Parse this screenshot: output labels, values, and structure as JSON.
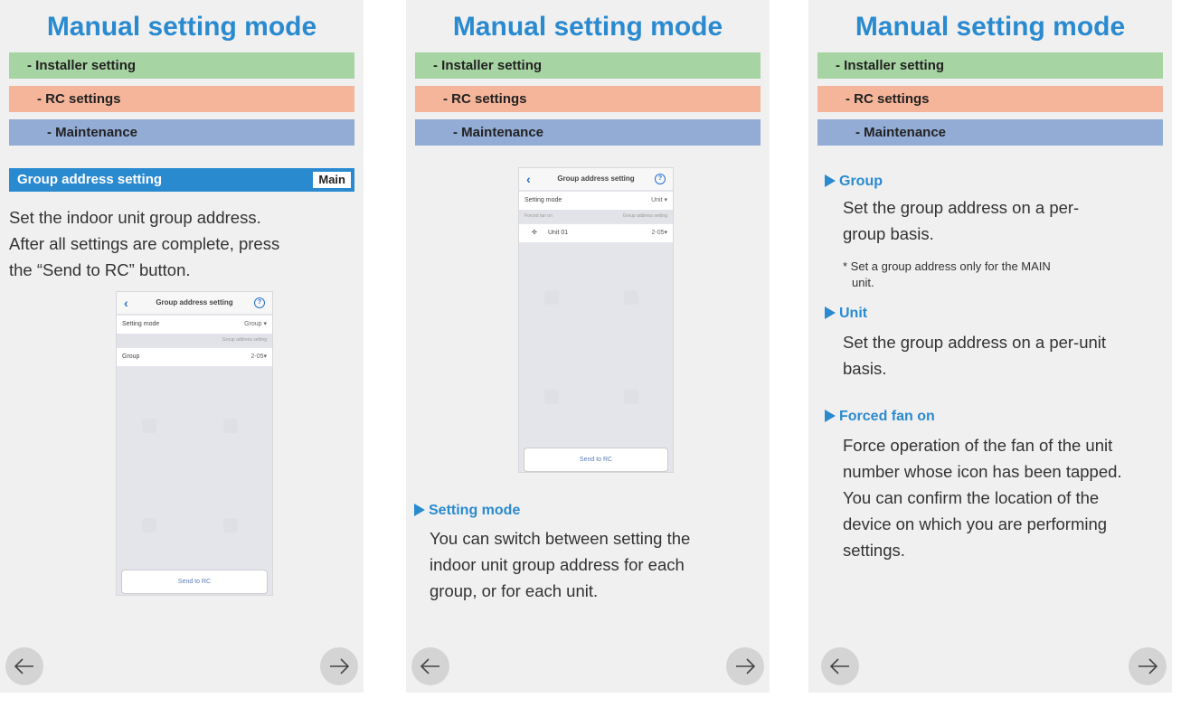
{
  "panel1": {
    "title": "Manual setting mode",
    "breadcrumb": [
      "- Installer setting",
      "- RC settings",
      "- Maintenance"
    ],
    "header": {
      "label": "Group address setting",
      "badge": "Main"
    },
    "desc": [
      "Set the indoor unit group address.",
      "After all settings are complete, press",
      "the “Send to RC” button."
    ],
    "phone": {
      "title": "Group address setting",
      "help": "?",
      "setting_mode_label": "Setting mode",
      "setting_mode_value": "Group ▾",
      "sub_right": "Group address setting",
      "row_label": "Group",
      "row_value": "2-05▾",
      "send_label": "Send to RC"
    }
  },
  "panel2": {
    "title": "Manual setting mode",
    "breadcrumb": [
      "- Installer setting",
      "- RC settings",
      "- Maintenance"
    ],
    "phone": {
      "title": "Group address setting",
      "help": "?",
      "setting_mode_label": "Setting mode",
      "setting_mode_value": "Unit ▾",
      "sub_left": "Forced fan on",
      "sub_right": "Group address setting",
      "row_label": "Unit  01",
      "row_value": "2-05▾",
      "send_label": "Send to RC"
    },
    "section": {
      "heading": "Setting mode",
      "lines": [
        "You can switch between setting the",
        "indoor unit group address for each",
        "group, or for each unit."
      ]
    }
  },
  "panel3": {
    "title": "Manual setting mode",
    "breadcrumb": [
      "- Installer setting",
      "- RC settings",
      "- Maintenance"
    ],
    "group": {
      "heading": "Group",
      "lines": [
        "Set the group address on a per-",
        "group basis."
      ],
      "note": [
        "* Set a group address only for the MAIN",
        "unit."
      ]
    },
    "unit": {
      "heading": "Unit",
      "lines": [
        "Set the group address on a per-unit",
        "basis."
      ]
    },
    "fan": {
      "heading": "Forced fan on",
      "lines": [
        "Force operation of the fan of the unit",
        "number whose icon has been tapped.",
        "You can confirm the location of the",
        "device on which you are performing",
        "settings."
      ]
    }
  }
}
